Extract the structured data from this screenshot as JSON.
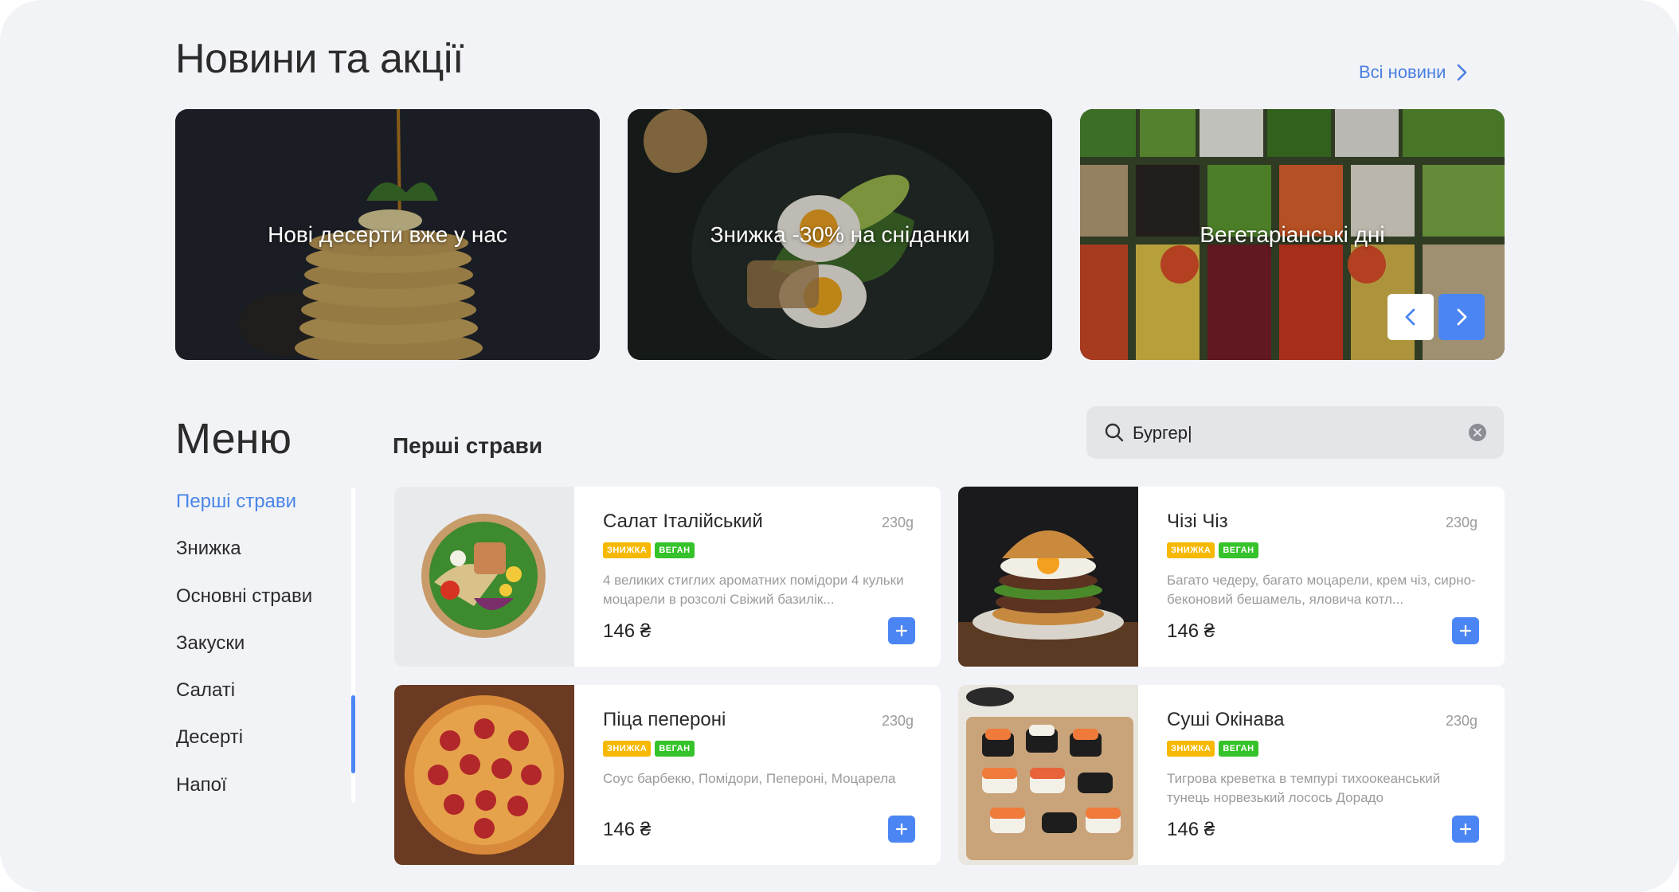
{
  "news": {
    "title": "Новини та акції",
    "all_link": "Всі новини",
    "promos": [
      {
        "label": "Нові десерти вже у нас"
      },
      {
        "label": "Знижка -30% на сніданки"
      },
      {
        "label": "Вегетаріанські дні"
      }
    ]
  },
  "menu": {
    "title": "Меню",
    "categories": [
      "Перші страви",
      "Знижка",
      "Основні страви",
      "Закуски",
      "Салаті",
      "Десерті",
      "Напої"
    ],
    "active_category": "Перші страви",
    "section_title": "Перші страви"
  },
  "search": {
    "value": "Бургер|"
  },
  "dishes": [
    {
      "name": "Салат Італійський",
      "weight": "230g",
      "tags": [
        "ЗНИЖКА",
        "ВЕГАН"
      ],
      "description": "4 великих стиглих ароматних помідори 4 кульки моцарели в розсолі Свіжий базилік...",
      "price": "146 ₴"
    },
    {
      "name": "Чізі Чіз",
      "weight": "230g",
      "tags": [
        "ЗНИЖКА",
        "ВЕГАН"
      ],
      "description": "Багато чедеру, багато моцарели, крем чіз, сирно-беконовий бешамель, яловича котл...",
      "price": "146 ₴"
    },
    {
      "name": "Піца пепероні",
      "weight": "230g",
      "tags": [
        "ЗНИЖКА",
        "ВЕГАН"
      ],
      "description": "Соус барбекю, Помідори, Пепероні, Моцарела",
      "price": "146 ₴"
    },
    {
      "name": "Суші Окінава",
      "weight": "230g",
      "tags": [
        "ЗНИЖКА",
        "ВЕГАН"
      ],
      "description": "Тигрова креветка в темпурі тихоокеанський тунець норвезький лосось Дорадо",
      "price": "146 ₴"
    }
  ],
  "colors": {
    "accent": "#4a85f3",
    "link": "#4a7fe0",
    "tag_sale": "#f6b800",
    "tag_vegan": "#35c22a",
    "background": "#f2f3f6"
  },
  "icons": {
    "all_news": "chevron-right-icon",
    "prev": "chevron-left-icon",
    "next": "chevron-right-icon",
    "search": "search-icon",
    "clear": "clear-icon",
    "add": "plus-icon"
  }
}
